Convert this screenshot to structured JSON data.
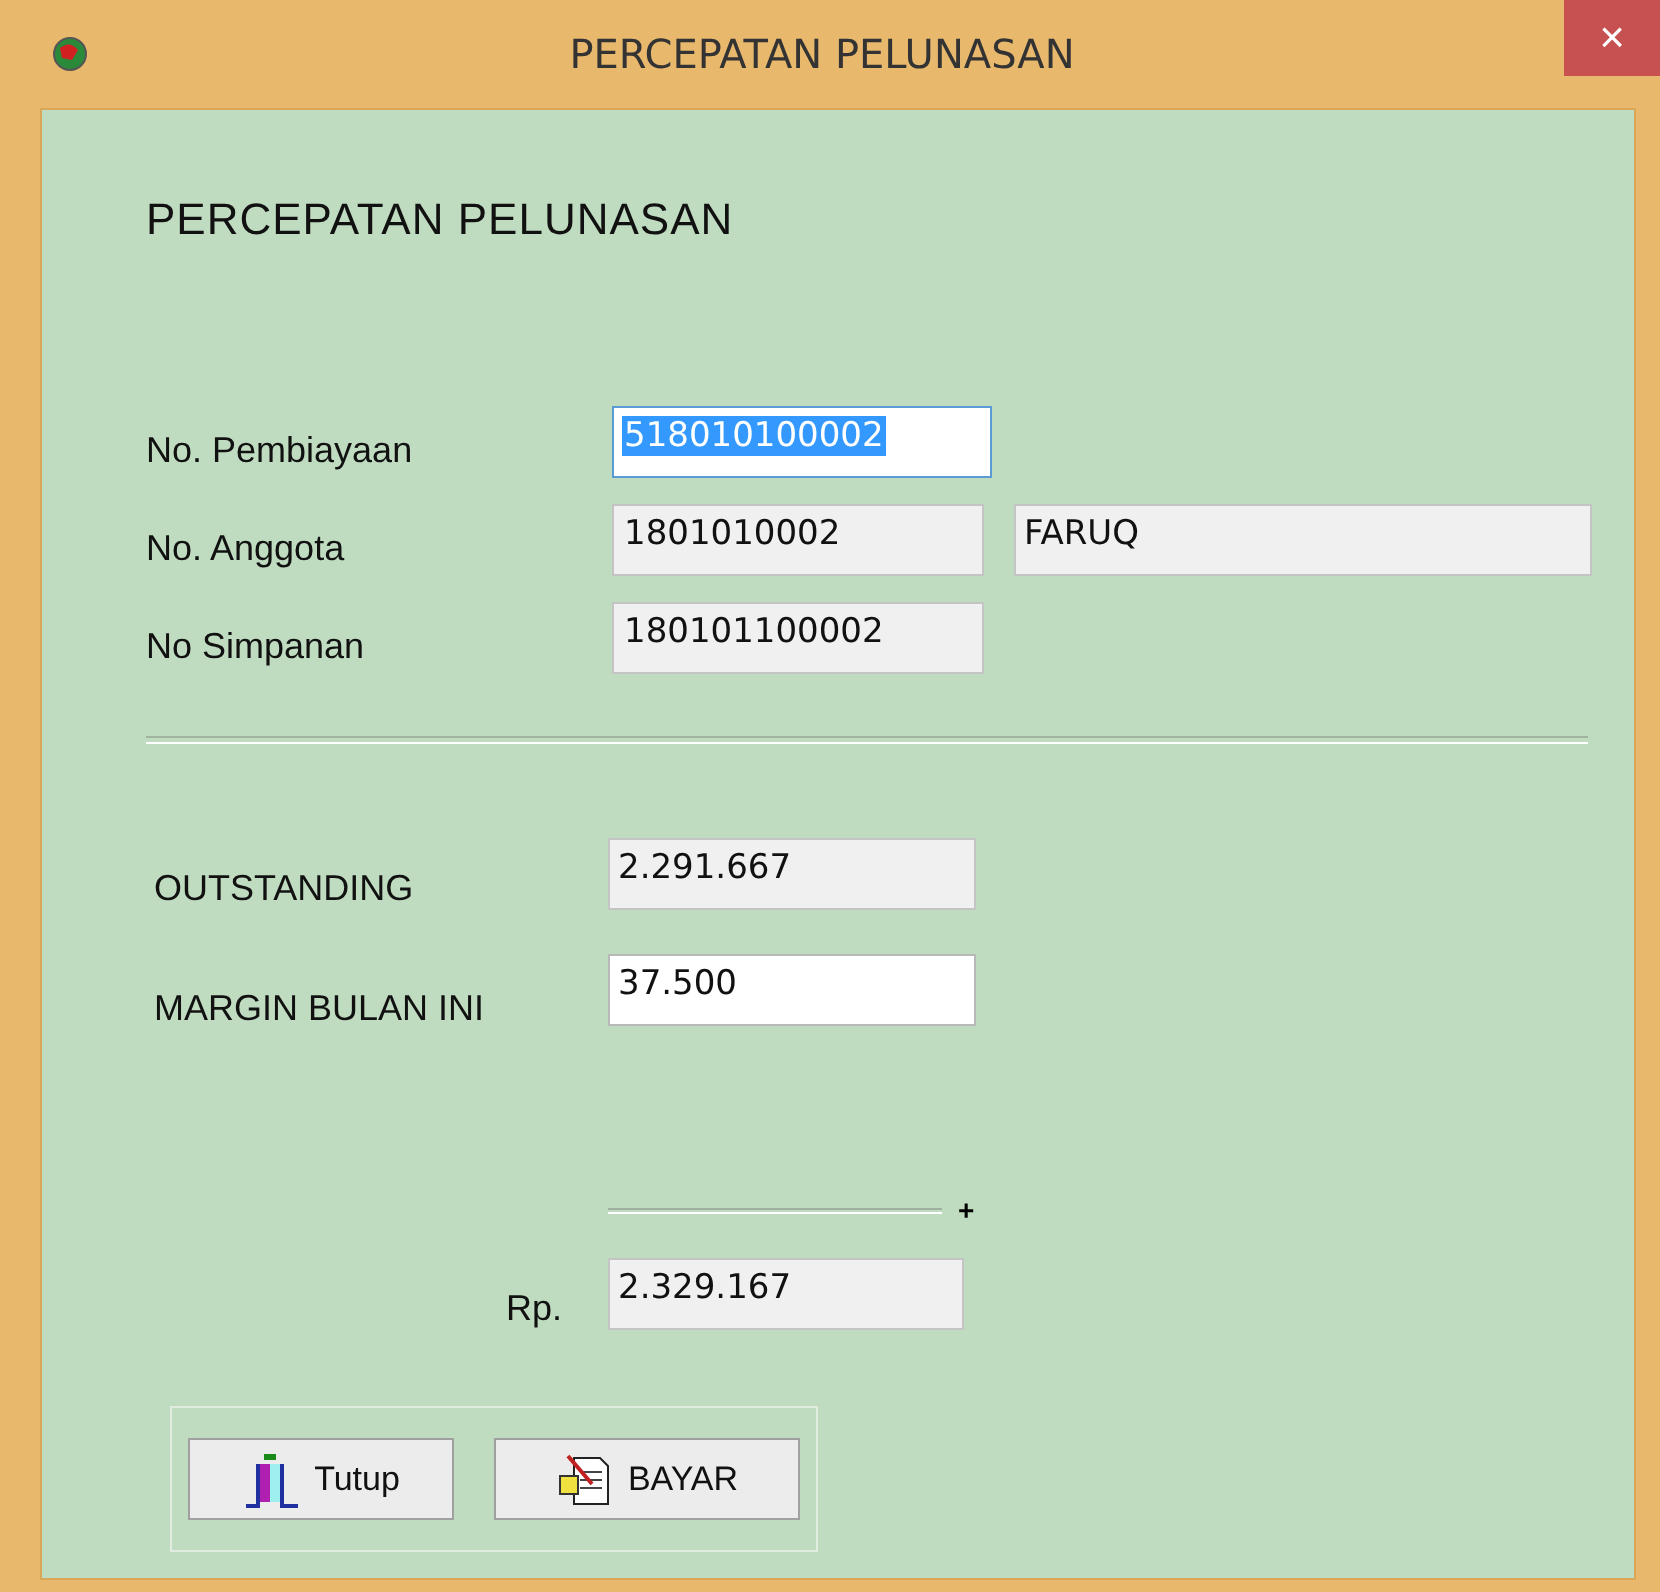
{
  "window": {
    "title": "PERCEPATAN PELUNASAN",
    "close": "×"
  },
  "heading": "PERCEPATAN PELUNASAN",
  "ids": [
    {
      "label": "No. Pembiayaan",
      "value": "518010100002",
      "kind": "editable",
      "focused": true
    },
    {
      "label": "No. Anggota",
      "value": "1801010002",
      "kind": "readonly",
      "focused": false,
      "extra": "FARUQ"
    },
    {
      "label": "No Simpanan",
      "value": "180101100002",
      "kind": "readonly",
      "focused": false
    }
  ],
  "amounts": [
    {
      "label": "OUTSTANDING",
      "value": "2.291.667",
      "kind": "readonly"
    },
    {
      "label": "MARGIN BULAN  INI",
      "value": "37.500",
      "kind": "editable"
    }
  ],
  "sum_sign": "+",
  "total": {
    "label": "Rp.",
    "value": "2.329.167"
  },
  "buttons": [
    {
      "label": "Tutup",
      "kind": "exit"
    },
    {
      "label": "BAYAR",
      "kind": "pay"
    }
  ]
}
